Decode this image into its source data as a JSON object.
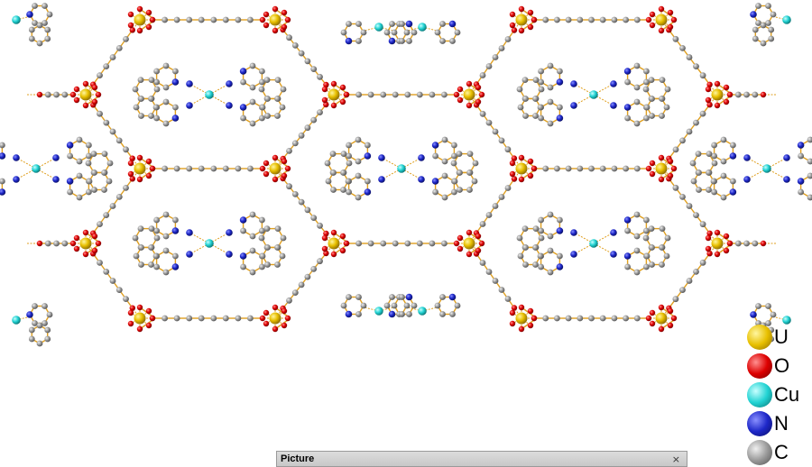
{
  "legend": {
    "items": [
      {
        "symbol": "U",
        "color": "#e8c000"
      },
      {
        "symbol": "O",
        "color": "#dd0000"
      },
      {
        "symbol": "Cu",
        "color": "#22d3d3"
      },
      {
        "symbol": "N",
        "color": "#1d27c8"
      },
      {
        "symbol": "C",
        "color": "#9a9a9a"
      }
    ]
  },
  "picture_window": {
    "title": "Picture",
    "close_glyph": "×"
  },
  "colors": {
    "bond": "#e0a020",
    "background": "#ffffff"
  }
}
